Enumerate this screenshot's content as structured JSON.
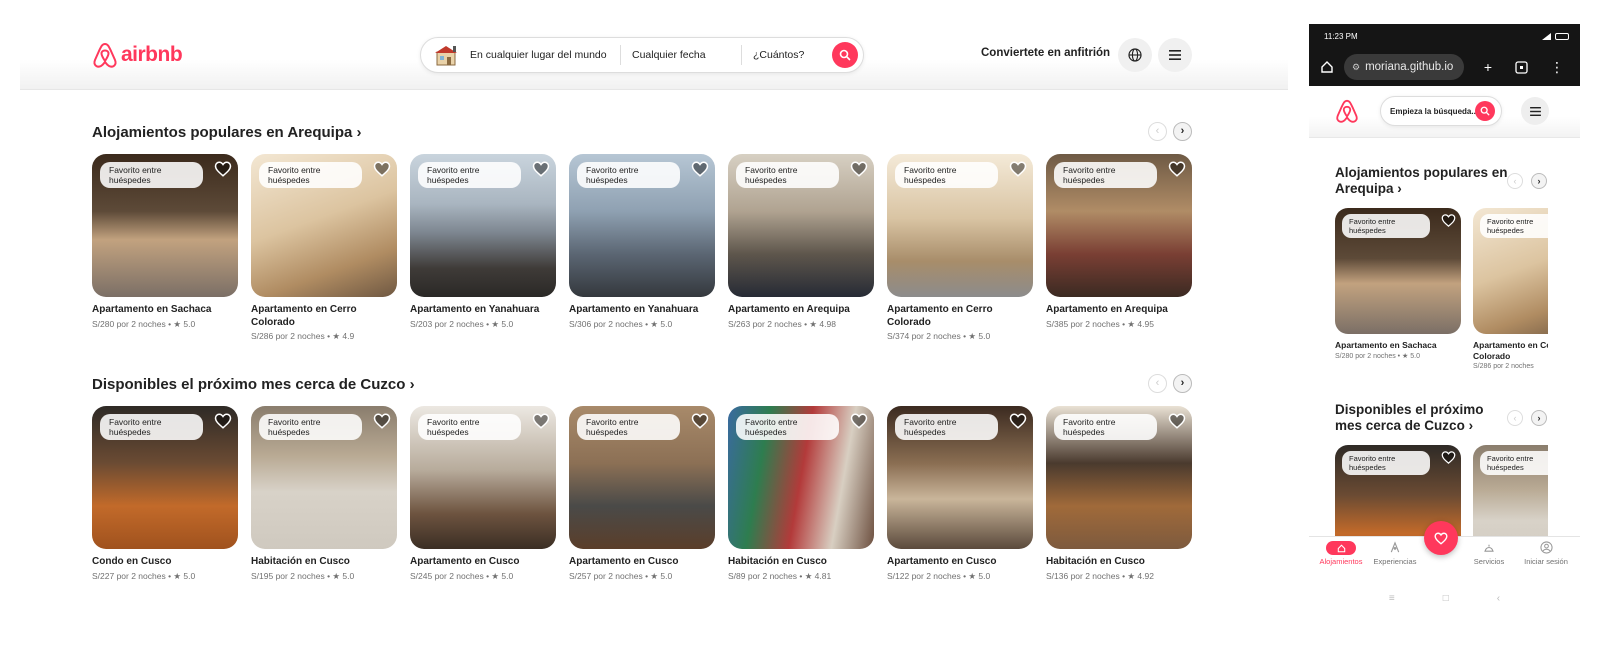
{
  "desktop": {
    "logo_text": "airbnb",
    "search": {
      "where": "En cualquier lugar del mundo",
      "when": "Cualquier fecha",
      "who": "¿Cuántos?"
    },
    "host_label": "Conviertete en anfitrión",
    "sections": [
      {
        "title": "Alojamientos populares en Arequipa ›",
        "cards": [
          {
            "badge": "Favorito entre huéspedes",
            "title": "Apartamento en Sachaca",
            "sub": "S/280 por 2 noches • ★ 5.0",
            "scene": "ph-kitchen"
          },
          {
            "badge": "Favorito entre huéspedes",
            "title": "Apartamento en Cerro Colorado",
            "sub": "S/286 por 2 noches • ★ 4.9",
            "scene": "ph-living-a"
          },
          {
            "badge": "Favorito entre huéspedes",
            "title": "Apartamento en Yanahuara",
            "sub": "S/203 por 2 noches • ★ 5.0",
            "scene": "ph-balcony"
          },
          {
            "badge": "Favorito entre huéspedes",
            "title": "Apartamento en Yanahuara",
            "sub": "S/306 por 2 noches • ★ 5.0",
            "scene": "ph-glass"
          },
          {
            "badge": "Favorito entre huéspedes",
            "title": "Apartamento en Arequipa",
            "sub": "S/263 por 2 noches • ★ 4.98",
            "scene": "ph-dining"
          },
          {
            "badge": "Favorito entre huéspedes",
            "title": "Apartamento en Cerro Colorado",
            "sub": "S/374 por 2 noches • ★ 5.0",
            "scene": "ph-open"
          },
          {
            "badge": "Favorito entre huéspedes",
            "title": "Apartamento en Arequipa",
            "sub": "S/385 por 2 noches • ★ 4.95",
            "scene": "ph-red"
          }
        ]
      },
      {
        "title": "Disponibles el próximo mes cerca de Cuzco ›",
        "cards": [
          {
            "badge": "Favorito entre huéspedes",
            "title": "Condo en Cusco",
            "sub": "S/227 por 2 noches • ★ 5.0",
            "scene": "ph-wood"
          },
          {
            "badge": "Favorito entre huéspedes",
            "title": "Habitación en Cusco",
            "sub": "S/195 por 2 noches • ★ 5.0",
            "scene": "ph-bed"
          },
          {
            "badge": "Favorito entre huéspedes",
            "title": "Apartamento en Cusco",
            "sub": "S/245 por 2 noches • ★ 5.0",
            "scene": "ph-kitchen2"
          },
          {
            "badge": "Favorito entre huéspedes",
            "title": "Apartamento en Cusco",
            "sub": "S/257 por 2 noches • ★ 5.0",
            "scene": "ph-sofa"
          },
          {
            "badge": "Favorito entre huéspedes",
            "title": "Habitación en Cusco",
            "sub": "S/89 por 2 noches • ★ 4.81",
            "scene": "ph-colorful"
          },
          {
            "badge": "Favorito entre huéspedes",
            "title": "Apartamento en Cusco",
            "sub": "S/122 por 2 noches • ★ 5.0",
            "scene": "ph-desk"
          },
          {
            "badge": "Favorito entre huéspedes",
            "title": "Habitación en Cusco",
            "sub": "S/136 por 2 noches • ★ 4.92",
            "scene": "ph-cozy"
          }
        ]
      }
    ]
  },
  "phone": {
    "status_time": "11:23 PM",
    "url": "moriana.github.io",
    "search_placeholder": "Empieza la búsqueda...",
    "sections": [
      {
        "title": "Alojamientos populares en Arequipa ›",
        "cards": [
          {
            "badge": "Favorito entre huéspedes",
            "title": "Apartamento en Sachaca",
            "sub": "S/280 por 2 noches • ★ 5.0",
            "scene": "ph-kitchen"
          },
          {
            "badge": "Favorito entre huéspedes",
            "title": "Apartamento en Cerro Colorado",
            "sub": "S/286 por 2 noches",
            "scene": "ph-living-a"
          }
        ]
      },
      {
        "title": "Disponibles el próximo mes cerca de Cuzco ›",
        "cards": [
          {
            "badge": "Favorito entre huéspedes",
            "title": "",
            "sub": "",
            "scene": "ph-wood"
          },
          {
            "badge": "Favorito entre huéspedes",
            "title": "",
            "sub": "",
            "scene": "ph-bed"
          }
        ]
      }
    ],
    "bottom_nav": {
      "alojamientos": "Alojamientos",
      "experiencias": "Experiencias",
      "servicios": "Servicios",
      "iniciar_sesion": "Iniciar sesión"
    },
    "colors": {
      "accent": "#ff385c"
    }
  }
}
